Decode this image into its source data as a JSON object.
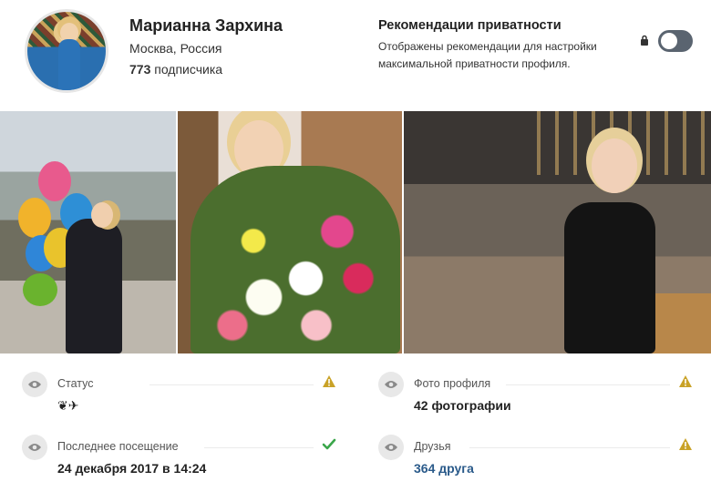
{
  "profile": {
    "name": "Марианна Зархина",
    "location": "Москва, Россия",
    "followers_count": "773",
    "followers_label": "подписчика"
  },
  "privacy": {
    "title": "Рекомендации приватности",
    "description": "Отображены рекомендации для настройки максимальной приватности профиля.",
    "toggle_on": false
  },
  "info": {
    "status": {
      "label": "Статус",
      "value": "❦✈",
      "state": "warning"
    },
    "profile_photo": {
      "label": "Фото профиля",
      "value": "42 фотографии",
      "state": "warning"
    },
    "last_seen": {
      "label": "Последнее посещение",
      "value": "24 декабря 2017 в 14:24",
      "state": "ok"
    },
    "friends": {
      "label": "Друзья",
      "value": "364 друга",
      "state": "warning"
    }
  },
  "colors": {
    "warning": "#c9a227",
    "ok": "#3aa64a",
    "link": "#2a5a8a",
    "toggle_off": "#5a6470"
  },
  "icons": {
    "lock": "lock-icon",
    "eye": "eye-icon",
    "warning": "warning-icon",
    "check": "check-icon"
  }
}
